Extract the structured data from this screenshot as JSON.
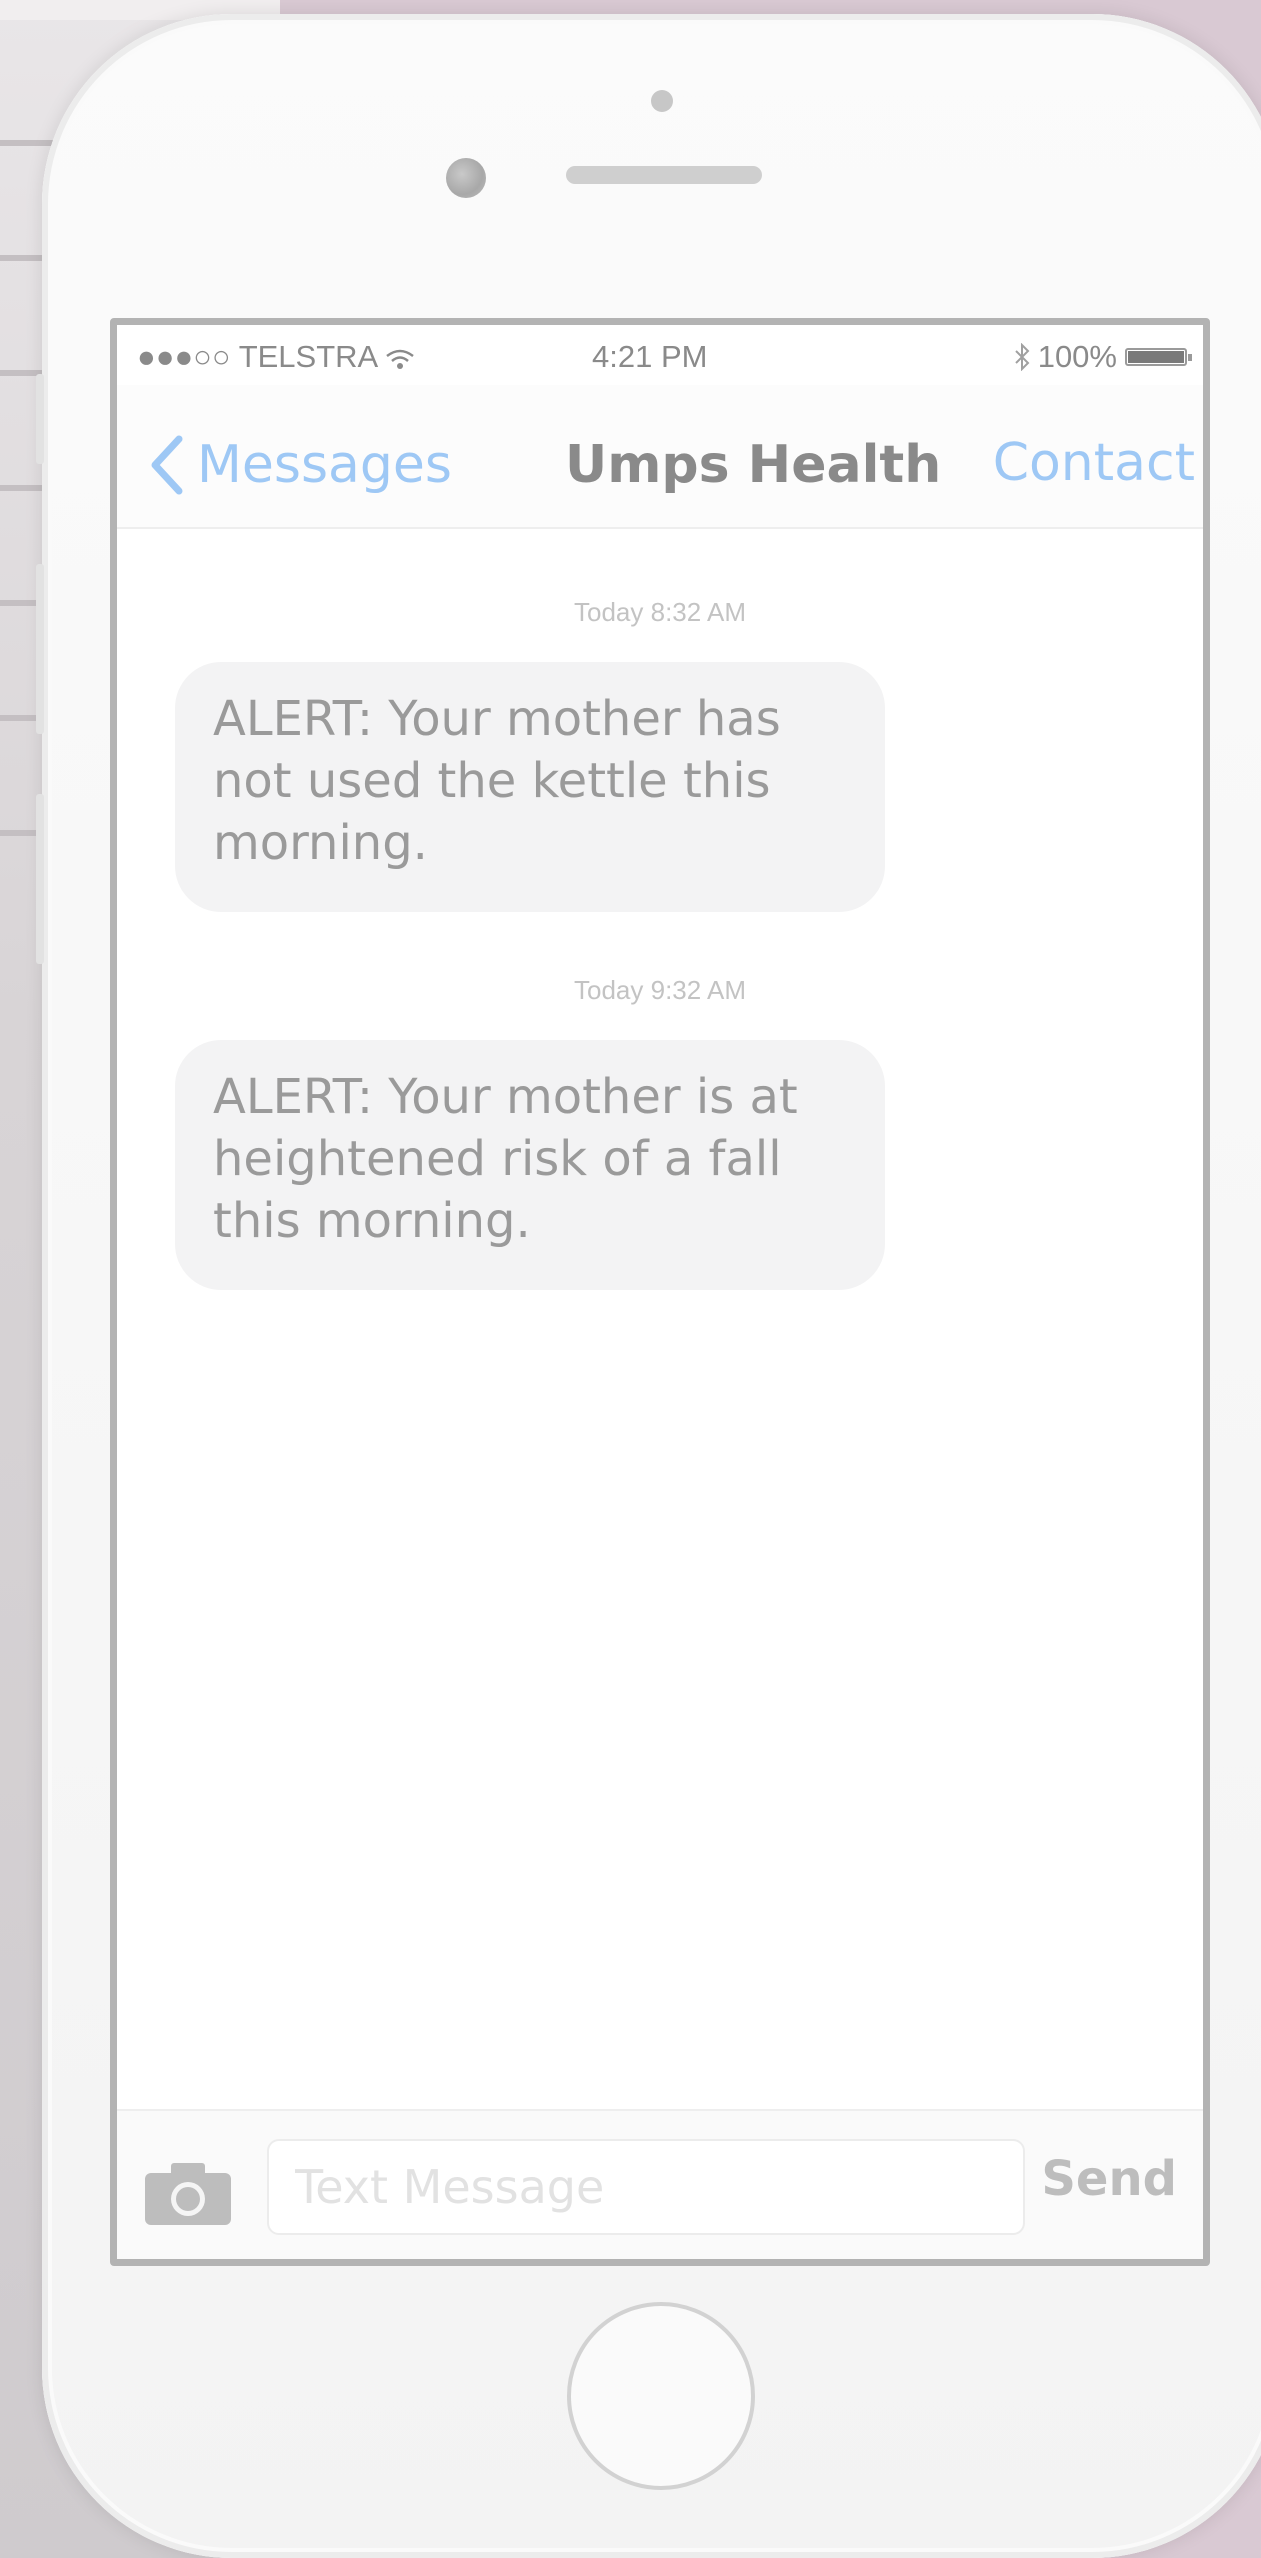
{
  "status_bar": {
    "signal": "●●●○○",
    "carrier": "TELSTRA",
    "time": "4:21 PM",
    "battery_percent": "100%"
  },
  "nav": {
    "back_label": "Messages",
    "title": "Umps Health",
    "contact_label": "Contact"
  },
  "messages": [
    {
      "timestamp": "Today 8:32 AM",
      "text": "ALERT: Your mother has not used the kettle this morning."
    },
    {
      "timestamp": "Today 9:32 AM",
      "text": "ALERT: Your mother is at heightened risk of a fall this morning."
    }
  ],
  "composer": {
    "placeholder": "Text Message",
    "send_label": "Send"
  },
  "colors": {
    "accent": "#9ec8f5",
    "bubble": "#f3f3f4",
    "background": "#d9c9d3"
  },
  "icons": [
    "wifi-icon",
    "bluetooth-icon",
    "battery-icon",
    "chevron-left-icon",
    "camera-icon"
  ]
}
